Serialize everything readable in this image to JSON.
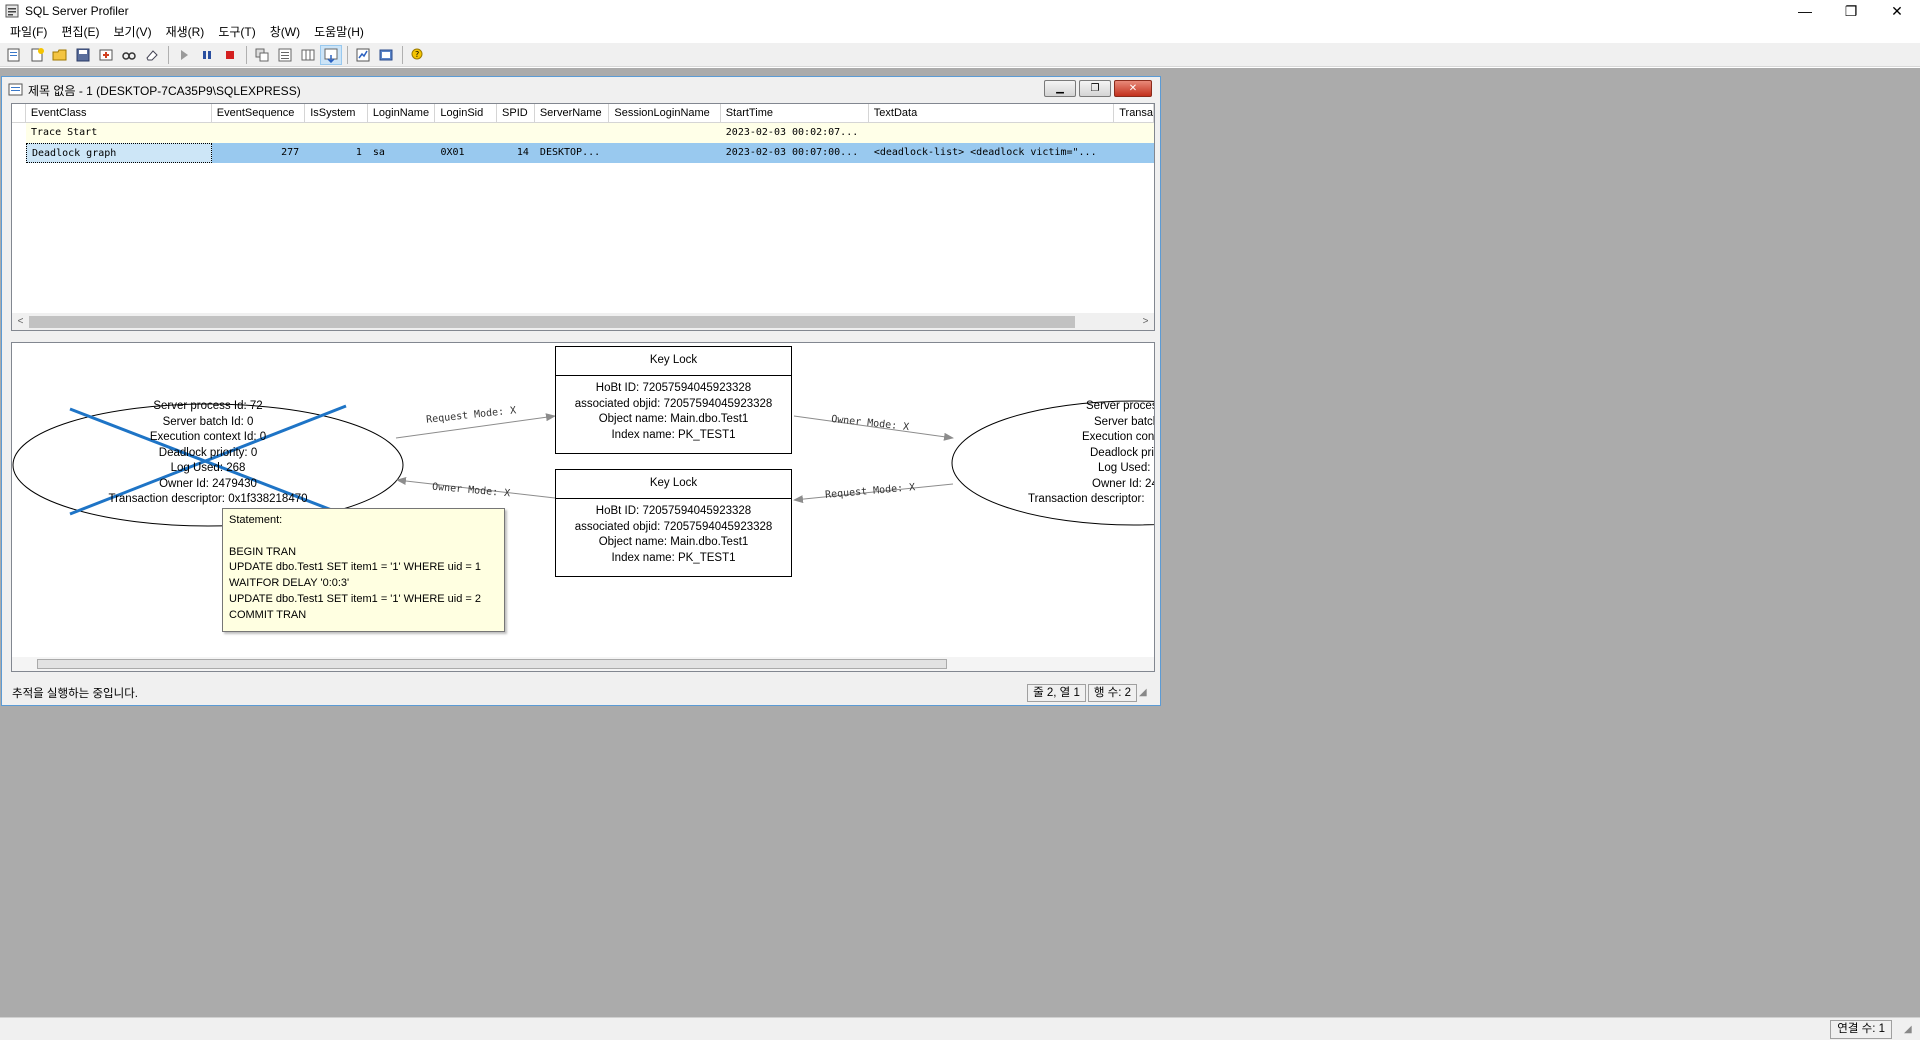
{
  "app": {
    "title": "SQL Server Profiler",
    "window_controls": {
      "minimize": "—",
      "restore": "❐",
      "close": "✕"
    }
  },
  "menu": [
    "파일(F)",
    "편집(E)",
    "보기(V)",
    "재생(R)",
    "도구(T)",
    "창(W)",
    "도움말(H)"
  ],
  "toolbar": {
    "buttons": [
      "new-trace",
      "new-template",
      "open",
      "save",
      "properties",
      "find",
      "clear",
      "run",
      "pause",
      "stop",
      "trace-properties",
      "auto-scroll",
      "clear-window",
      "show-column",
      "perfmon",
      "database-tuning",
      "help"
    ]
  },
  "child": {
    "title": "제목 없음 - 1 (DESKTOP-7CA35P9\\SQLEXPRESS)",
    "controls": {
      "minimize": "▁",
      "restore": "❐",
      "close": "✕"
    }
  },
  "grid": {
    "columns": [
      "EventClass",
      "EventSequence",
      "IsSystem",
      "LoginName",
      "LoginSid",
      "SPID",
      "ServerName",
      "SessionLoginName",
      "StartTime",
      "TextData",
      "Transa"
    ],
    "rows": [
      [
        "Trace Start",
        "",
        "",
        "",
        "",
        "",
        "",
        "",
        "2023-02-03 00:02:07...",
        "",
        ""
      ],
      [
        "Deadlock graph",
        "277",
        "1",
        "sa",
        "0X01",
        "14",
        "DESKTOP...",
        "",
        "2023-02-03 00:07:00...",
        "<deadlock-list>   <deadlock victim=\"...",
        ""
      ]
    ],
    "scroll_left": "<",
    "scroll_right": ">"
  },
  "graph": {
    "victim_process": {
      "lines": [
        "Server process Id: 72",
        "Server batch Id: 0",
        "Execution context Id: 0",
        "Deadlock priority: 0",
        "Log Used: 268",
        "Owner Id: 2479430",
        "Transaction descriptor: 0x1f338218470"
      ]
    },
    "other_process": {
      "lines": [
        "Server proces",
        "Server batch",
        "Execution cont",
        "Deadlock pri",
        "Log Used:",
        "Owner Id: 24",
        "Transaction descriptor:"
      ]
    },
    "key_locks": [
      {
        "title": "Key Lock",
        "lines": [
          "HoBt ID: 72057594045923328",
          "associated objid: 72057594045923328",
          "Object name: Main.dbo.Test1",
          "Index name: PK_TEST1"
        ]
      },
      {
        "title": "Key Lock",
        "lines": [
          "HoBt ID: 72057594045923328",
          "associated objid: 72057594045923328",
          "Object name: Main.dbo.Test1",
          "Index name: PK_TEST1"
        ]
      }
    ],
    "edges": [
      "Request Mode: X",
      "Owner Mode: X",
      "Owner Mode: X",
      "Request Mode: X"
    ],
    "tooltip": {
      "lines": [
        "Statement:",
        "",
        "BEGIN TRAN",
        "UPDATE dbo.Test1 SET item1 = '1' WHERE uid = 1",
        "WAITFOR DELAY '0:0:3'",
        "UPDATE dbo.Test1 SET item1 = '1' WHERE uid = 2",
        "COMMIT TRAN"
      ]
    },
    "colors": {
      "victim_cross": "#1e74c6",
      "edge": "#8c8c8c"
    }
  },
  "child_status": {
    "text": "추적을 실행하는 중입니다.",
    "position": "줄 2, 열 1",
    "rows": "행 수: 2"
  },
  "app_status": {
    "connections": "연결 수: 1"
  }
}
